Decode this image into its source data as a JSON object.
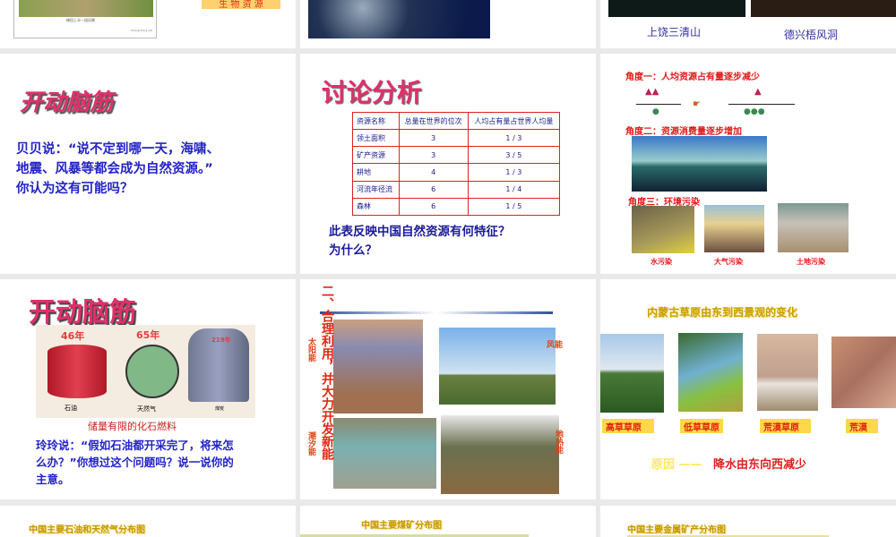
{
  "slides_top": {
    "s1": {
      "label": "生 物 资 源",
      "photo_caption": "梯田上半一段风景",
      "watermark": "zhongzhong.net"
    },
    "s3": {
      "captions": [
        "上饶三清山",
        "德兴梧风洞"
      ]
    }
  },
  "slide_brain1": {
    "title": "开动脑筋",
    "text": [
      "贝贝说：“说不定到哪一天，海啸、",
      "地震、风暴等都会成为自然资源。”",
      "你认为这有可能吗？"
    ]
  },
  "slide_table": {
    "title": "讨论分析",
    "headers": [
      "资源名称",
      "总量在世界的位次",
      "人均占有量占世界人均量"
    ],
    "rows": [
      [
        "领土面积",
        "3",
        "1 / 3"
      ],
      [
        "矿产资源",
        "3",
        "3 / 5"
      ],
      [
        "耕地",
        "4",
        "1 / 3"
      ],
      [
        "河流年径流",
        "6",
        "1 / 4"
      ],
      [
        "森林",
        "6",
        "1 / 5"
      ]
    ],
    "question": [
      "此表反映中国自然资源有何特征？",
      "为什么？"
    ]
  },
  "slide_angles": {
    "angle1": "角度一：人均资源占有量逐步减少",
    "angle2": "角度二：资源消费量逐步增加",
    "angle3": "角度三：环境污染",
    "captions": [
      "水污染",
      "大气污染",
      "土地污染"
    ]
  },
  "slide_brain2": {
    "title": "开动脑筋",
    "years": [
      "46年",
      "65年",
      "219年"
    ],
    "fuels": [
      "石油",
      "天然气",
      "煤炭"
    ],
    "caption": "储量有限的化石燃料",
    "text": [
      "玲玲说：“假如石油都开采完了，将来怎",
      "么办？”你想过这个问题吗？说一说你的",
      "主意。"
    ]
  },
  "slide_energy": {
    "heading": "二、合理利用，并大力开发新能",
    "labels": [
      "太阳能",
      "风能",
      "潮汐能",
      "地热能"
    ]
  },
  "slide_grass": {
    "title": "内蒙古草原由东到西景观的变化",
    "stages": [
      "高草草原",
      "低草草原",
      "荒漠草原",
      "荒漠"
    ],
    "reason_label": "原因 ——",
    "reason": "降水由东向西减少"
  },
  "slides_bottom": [
    "中国主要石油和天然气分布图",
    "中国主要煤矿分布图",
    "中国主要金属矿产分布图"
  ]
}
